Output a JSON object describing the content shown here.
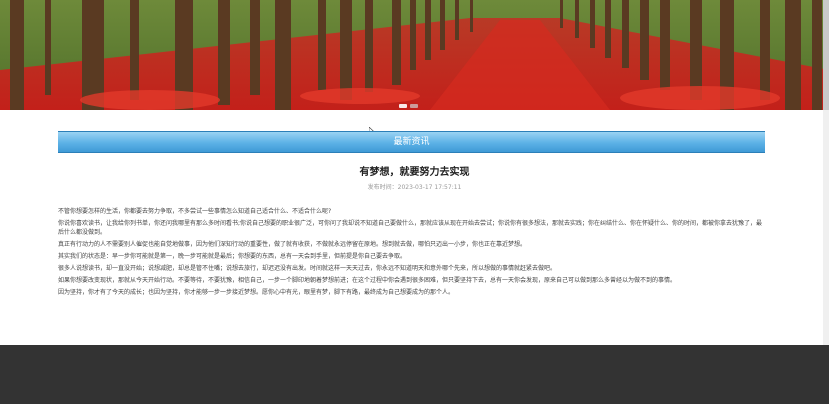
{
  "banner": {
    "image_description_icon": "banner-image",
    "colors": {
      "foliage": "#c52a1f",
      "trunk": "#5a3a22",
      "grass": "#5b7a2c"
    }
  },
  "section": {
    "title": "最新资讯"
  },
  "article": {
    "title": "有梦想，就要努力去实现",
    "meta": "发布时间：2023-03-17 17:57:11",
    "paragraphs": [
      "不管你想要怎样的生活，你都要去努力争取，不多尝试一些事情怎么知道自己适合什么、不适合什么呢?",
      "你说你喜欢读书，让我给你列书单，你还问我哪里有那么多时间看书;你说自己想要的职业很广泛，可你问了我却说不知道自己要做什么，那就应该从现在开始去尝试；你说你有很多想法，那就去实践；你在纠结什么、你在怀疑什么、你的时间，都被你拿去犹豫了，最后什么都没做到。",
      "真正有行动力的人不需要别人催促也能自觉地做事，因为他们深知行动的重要性，做了就有收获，不做就永远停留在原地。想到就去做，哪怕只迈出一小步，你也正在靠近梦想。",
      "其实我们的状态是：早一步你可能就是第一，晚一步可能就是最后；你想要的东西，总有一天会到手里，但前提是你自己要去争取。",
      "很多人说想读书，却一直没开始；说想减肥，却总是管不住嘴；说想去旅行，却迟迟没有出发。时间就这样一天天过去，你永远不知道明天和意外哪个先来，所以想做的事情就赶紧去做吧。",
      "如果你想要改变现状，那就从今天开始行动。不要等待，不要犹豫，相信自己，一步一个脚印地朝着梦想前进；在这个过程中你会遇到很多困难，但只要坚持下去，总有一天你会发现，原来自己可以做到那么多曾经以为做不到的事情。",
      "因为坚持，你才有了今天的成长；也因为坚持，你才能够一步一步接近梦想。愿你心中有光，眼里有梦，脚下有路，最终成为自己想要成为的那个人。"
    ]
  },
  "slider": {
    "active_index": 0,
    "count": 2
  },
  "footer": {
    "color": "#333333"
  }
}
